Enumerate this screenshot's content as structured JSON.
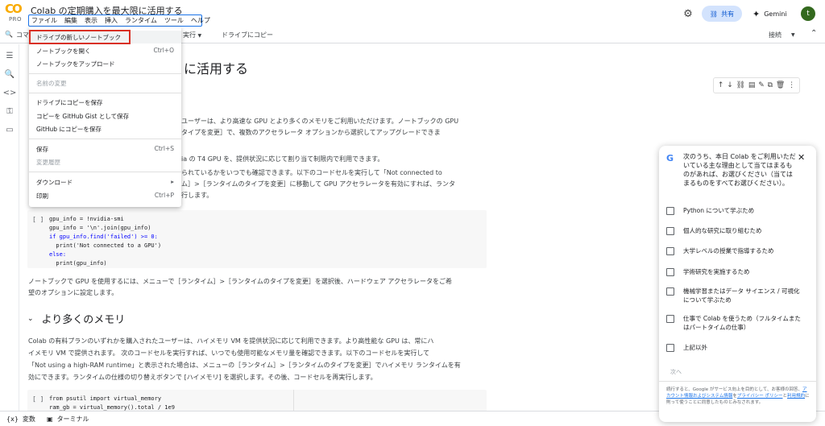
{
  "header": {
    "logo_text": "CO",
    "logo_badge": "PRO",
    "notebook_title": "Colab の定期購入を最大限に活用する",
    "menu": [
      "ファイル",
      "編集",
      "表示",
      "挿入",
      "ランタイム",
      "ツール",
      "ヘルプ"
    ],
    "share_label": "共有",
    "gemini_label": "Gemini",
    "avatar_letter": "t"
  },
  "toolbar": {
    "partial_left": "コマ",
    "run_all": "実行",
    "copy_to_drive": "ドライブにコピー",
    "connect": "接続"
  },
  "file_menu": {
    "items": [
      {
        "label": "ドライブの新しいノートブック",
        "shortcut": "",
        "disabled": false
      },
      {
        "label": "ノートブックを開く",
        "shortcut": "Ctrl+O",
        "disabled": false
      },
      {
        "label": "ノートブックをアップロード",
        "shortcut": "",
        "disabled": false
      },
      {
        "label": "名前の変更",
        "shortcut": "",
        "disabled": true
      },
      {
        "label": "ドライブにコピーを保存",
        "shortcut": "",
        "disabled": false
      },
      {
        "label": "コピーを GitHub Gist として保存",
        "shortcut": "",
        "disabled": false
      },
      {
        "label": "GitHub にコピーを保存",
        "shortcut": "",
        "disabled": false
      },
      {
        "label": "保存",
        "shortcut": "Ctrl+S",
        "disabled": false
      },
      {
        "label": "変更履歴",
        "shortcut": "",
        "disabled": true
      },
      {
        "label": "ダウンロード",
        "shortcut": "",
        "disabled": false
      },
      {
        "label": "印刷",
        "shortcut": "Ctrl+P",
        "disabled": false
      }
    ]
  },
  "notebook": {
    "heading_fragment": "に活用する",
    "lines": [
      "ユーザーは、より高速な GPU とより多くのメモリをご利用いただけます。ノートブックの GPU",
      "タイプを変更］で、複数のアクセラレータ オプションから選択してアップグレードできま",
      "ia の T4 GPU を、提供状況に応じて割り当て制限内で利用できます。",
      "られているかをいつでも確認できます。以下のコードセルを実行して「Not connected to",
      "ム］>［ランタイムのタイプを変更］に移動して GPU アクセラレータを有効にすれば、ランタ",
      "行します。"
    ],
    "code1": {
      "run": "[ ]",
      "lines": [
        "gpu_info = !nvidia-smi",
        "gpu_info = '\\n'.join(gpu_info)",
        "if gpu_info.find('failed') >= 0:",
        "  print('Not connected to a GPU')",
        "else:",
        "  print(gpu_info)"
      ]
    },
    "gpu_para": [
      "ノートブックで GPU を使用するには、メニューで［ランタイム］>［ランタイムのタイプを変更］を選択後、ハードウェア アクセラレータをご希",
      "望のオプションに設定します。"
    ],
    "section_chevron": "⌄",
    "section_title": "より多くのメモリ",
    "memory_para": [
      "Colab の有料プランのいずれかを購入されたユーザーは、ハイメモリ VM を提供状況に応じて利用できます。より高性能な GPU は、常にハ",
      "イメモリ VM で提供されます。 次のコードセルを実行すれば、いつでも使用可能なメモリ量を確認できます。以下のコードセルを実行して",
      "「Not using a high-RAM runtime」と表示された場合は、メニューの［ランタイム］>［ランタイムのタイプを変更］でハイメモリ ランタイムを有",
      "効にできます。ランタイムの仕様の切り替えボタンで [ハイメモリ] を選択します。その後、コードセルを再実行します。"
    ],
    "code2": {
      "run": "[ ]",
      "lines": [
        "from psutil import virtual_memory",
        "ram_gb = virtual_memory().total / 1e9"
      ]
    }
  },
  "statusbar": {
    "variables": "変数",
    "terminal": "ターミナル"
  },
  "survey": {
    "question": "次のうち、本日 Colab をご利用いただいている主な理由として当てはまるものがあれば、お選びください（当てはまるものをすべてお選びください）。",
    "options": [
      "Python について学ぶため",
      "個人的な研究に取り組むため",
      "大学レベルの授業で指導するため",
      "学術研究を実施するため",
      "機械学習またはデータ サイエンス / 可視化について学ぶため",
      "仕事で Colab を使うため（フルタイムまたはパートタイムの仕事）",
      "上記以外"
    ],
    "next_label": "次へ",
    "disclaimer_a": "続行すると、Google がサービス向上を目的として、お客様の回答、",
    "disclaimer_link1": "アカウント情報およびシステム情報",
    "disclaimer_b": "を",
    "disclaimer_link2": "プライバシー ポリシー",
    "disclaimer_c": "と",
    "disclaimer_link3": "利用規約",
    "disclaimer_d": "に則って使うことに同意したものとみなされます。"
  },
  "colors": {
    "accent": "#1a73e8",
    "share_bg": "#d3e3fd",
    "highlight_border": "#d93025",
    "avatar_bg": "#33691e"
  }
}
